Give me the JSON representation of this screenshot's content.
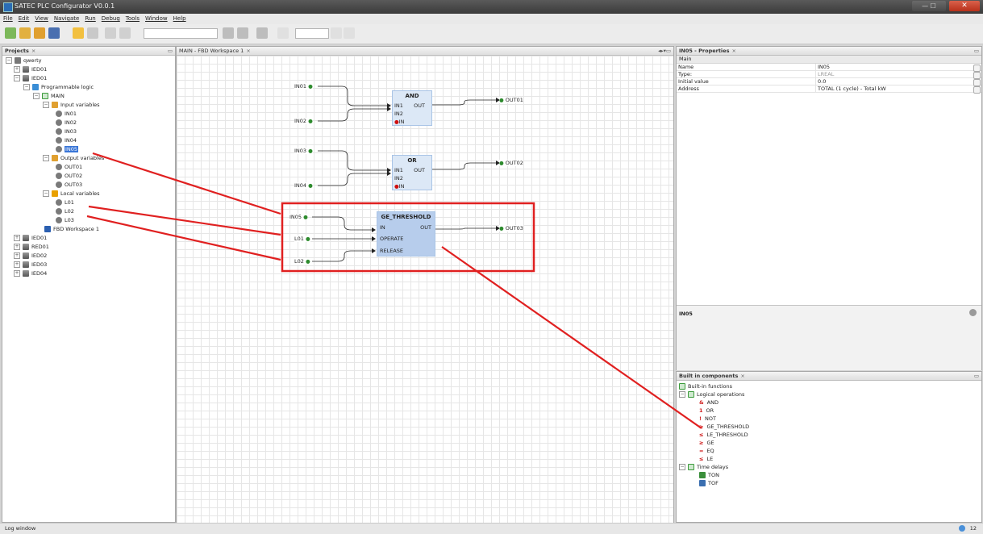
{
  "window": {
    "title": "SATEC PLC Configurator V0.0.1"
  },
  "menu": [
    "File",
    "Edit",
    "View",
    "Navigate",
    "Run",
    "Debug",
    "Tools",
    "Window",
    "Help"
  ],
  "projects": {
    "title": "Projects",
    "tree": [
      {
        "label": "qwerty"
      },
      {
        "label": "IED01"
      },
      {
        "label": "IED01"
      },
      {
        "label": "Programmable logic"
      },
      {
        "label": "MAIN"
      },
      {
        "label": "Input variables"
      },
      {
        "label": "IN01"
      },
      {
        "label": "IN02"
      },
      {
        "label": "IN03"
      },
      {
        "label": "IN04"
      },
      {
        "label": "IN05"
      },
      {
        "label": "Output variables"
      },
      {
        "label": "OUT01"
      },
      {
        "label": "OUT02"
      },
      {
        "label": "OUT03"
      },
      {
        "label": "Local variables"
      },
      {
        "label": "L01"
      },
      {
        "label": "L02"
      },
      {
        "label": "L03"
      },
      {
        "label": "FBD Workspace 1"
      },
      {
        "label": "IED01"
      },
      {
        "label": "RED01"
      },
      {
        "label": "IED02"
      },
      {
        "label": "IED03"
      },
      {
        "label": "IED04"
      }
    ]
  },
  "workspace": {
    "tab": "MAIN - FBD Workspace 1",
    "blocks": {
      "and": {
        "title": "AND",
        "in1": "IN1",
        "in2": "IN2",
        "out": "OUT",
        "en": "IN"
      },
      "or": {
        "title": "OR",
        "in1": "IN1",
        "in2": "IN2",
        "out": "OUT",
        "en": "IN"
      },
      "ge": {
        "title": "GE_THRESHOLD",
        "in": "IN",
        "operate": "OPERATE",
        "release": "RELEASE",
        "out": "OUT"
      }
    },
    "vars": {
      "in01": "IN01",
      "in02": "IN02",
      "in03": "IN03",
      "in04": "IN04",
      "in05": "IN05",
      "l01": "L01",
      "l02": "L02",
      "out01": "OUT01",
      "out02": "OUT02",
      "out03": "OUT03"
    }
  },
  "properties": {
    "title": "IN05 - Properties",
    "section": "Main",
    "rows": [
      {
        "name": "Name",
        "value": "IN05"
      },
      {
        "name": "Type:",
        "value": "LREAL"
      },
      {
        "name": "Initial value",
        "value": "0.0"
      },
      {
        "name": "Address",
        "value": "TOTAL (1 cycle) - Total kW"
      }
    ],
    "description_title": "IN05"
  },
  "builtin": {
    "title": "Built in components",
    "items": [
      {
        "label": "Built-in functions",
        "icon": "folder"
      },
      {
        "label": "Logical operations",
        "icon": "folder"
      },
      {
        "label": "AND",
        "glyph": "&"
      },
      {
        "label": "OR",
        "glyph": "1"
      },
      {
        "label": "NOT",
        "glyph": "!"
      },
      {
        "label": "GE_THRESHOLD",
        "glyph": "≥"
      },
      {
        "label": "LE_THRESHOLD",
        "glyph": "≤"
      },
      {
        "label": "GE",
        "glyph": "≥"
      },
      {
        "label": "EQ",
        "glyph": "="
      },
      {
        "label": "LE",
        "glyph": "≤"
      },
      {
        "label": "Time delays",
        "icon": "folder"
      },
      {
        "label": "TON",
        "icon": "timer"
      },
      {
        "label": "TOF",
        "icon": "timer"
      }
    ]
  },
  "status": {
    "log": "Log window",
    "count": "12"
  },
  "colors": {
    "accent": "#3875d7",
    "annotation": "#e02020",
    "block": "#dce8f6",
    "pin": "#2e8b2e"
  }
}
